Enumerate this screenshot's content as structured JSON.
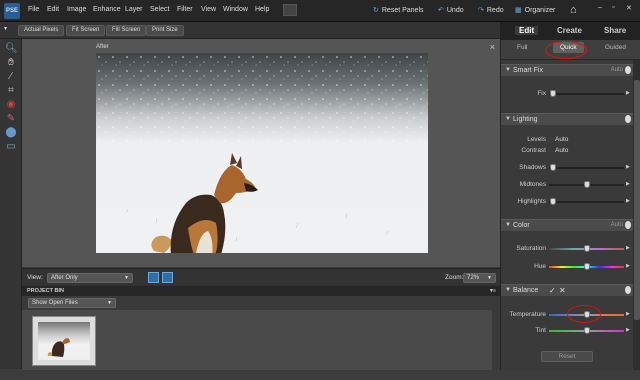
{
  "app": {
    "logo_text": "PSE"
  },
  "menu": [
    "File",
    "Edit",
    "Image",
    "Enhance",
    "Layer",
    "Select",
    "Filter",
    "View",
    "Window",
    "Help"
  ],
  "toolbar": {
    "reset_panels": "Reset Panels",
    "undo": "Undo",
    "redo": "Redo",
    "organizer": "Organizer"
  },
  "options_bar": {
    "actual_pixels": "Actual Pixels",
    "fit_screen": "Fit Screen",
    "fill_screen": "Fill Screen",
    "print_size": "Print Size"
  },
  "document": {
    "title": "After"
  },
  "status": {
    "view_label": "View:",
    "view_value": "After Only",
    "zoom_label": "Zoom:",
    "zoom_value": "72%"
  },
  "project_bin": {
    "header": "PROJECT BIN",
    "select_value": "Show Open Files"
  },
  "panel": {
    "tabs": [
      "Edit",
      "Create",
      "Share"
    ],
    "active_tab": "Edit",
    "subtabs": [
      "Full",
      "Quick",
      "Guided"
    ],
    "active_subtab": "Quick",
    "smart_fix": {
      "title": "Smart Fix",
      "auto": "Auto",
      "fix_label": "Fix",
      "fix_level": 0.02
    },
    "lighting": {
      "title": "Lighting",
      "levels_label": "Levels",
      "levels_value": "Auto",
      "contrast_label": "Contrast",
      "contrast_value": "Auto",
      "shadows_label": "Shadows",
      "shadows_level": 0.02,
      "midtones_label": "Midtones",
      "midtones_level": 0.5,
      "highlights_label": "Highlights",
      "highlights_level": 0.02
    },
    "color": {
      "title": "Color",
      "auto": "Auto",
      "saturation_label": "Saturation",
      "saturation_level": 0.5,
      "hue_label": "Hue",
      "hue_level": 0.5
    },
    "balance": {
      "title": "Balance",
      "temperature_label": "Temperature",
      "temperature_level": 0.5,
      "tint_label": "Tint",
      "tint_level": 0.5
    },
    "reset_label": "Reset"
  },
  "colors": {
    "accent_blue": "#6fa8dc",
    "highlight_red": "#e01010",
    "panel_bg": "#3a3a3a"
  }
}
